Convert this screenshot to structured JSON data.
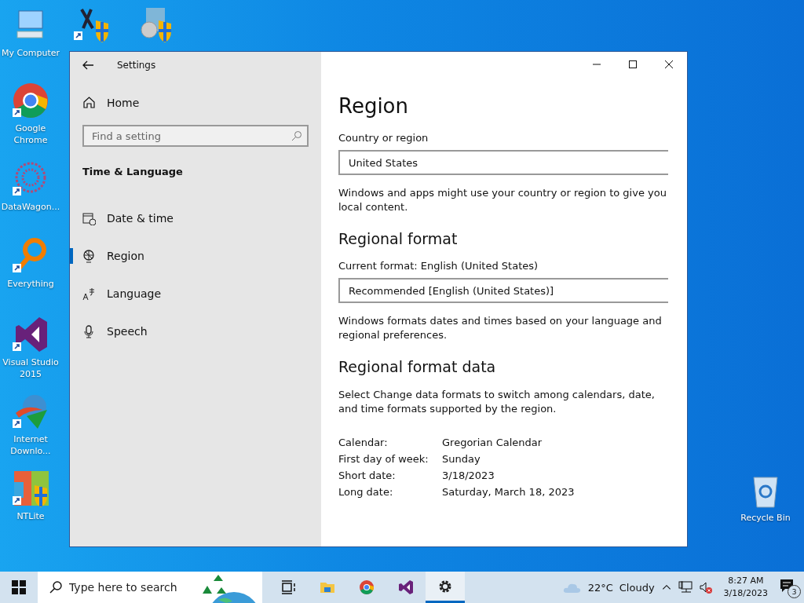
{
  "desktop_icons": [
    {
      "kind": "computer",
      "label": "My Computer"
    },
    {
      "kind": "tool-shield"
    },
    {
      "kind": "disc-shield"
    },
    {
      "kind": "chrome",
      "label": "Google Chrome"
    },
    {
      "kind": "mesh",
      "label": "DataWagon..."
    },
    {
      "kind": "magnifier",
      "label": "Everything"
    },
    {
      "kind": "vs",
      "label": "Visual Studio 2015"
    },
    {
      "kind": "globe-arrow",
      "label": "Internet Downlo..."
    },
    {
      "kind": "ntlite",
      "label": "NTLite"
    },
    {
      "kind": "recycle",
      "label": "Recycle Bin"
    }
  ],
  "window": {
    "title": "Settings",
    "home": "Home",
    "search": {
      "placeholder": "Find a setting"
    },
    "section": "Time & Language",
    "nav": [
      {
        "label": "Date & time",
        "selected": false
      },
      {
        "label": "Region",
        "selected": true
      },
      {
        "label": "Language",
        "selected": false
      },
      {
        "label": "Speech",
        "selected": false
      }
    ],
    "heading": "Region",
    "country_label": "Country or region",
    "country_value": "United States",
    "country_note": "Windows and apps might use your country or region to give you local content.",
    "format_heading": "Regional format",
    "format_label": "Current format: English (United States)",
    "format_value": "Recommended [English (United States)]",
    "format_note": "Windows formats dates and times based on your language and regional preferences.",
    "data_heading": "Regional format data",
    "data_note": "Select Change data formats to switch among calendars, date, and time formats supported by the region.",
    "data_rows": [
      {
        "label": "Calendar:",
        "value": "Gregorian Calendar"
      },
      {
        "label": "First day of week:",
        "value": "Sunday"
      },
      {
        "label": "Short date:",
        "value": "3/18/2023"
      },
      {
        "label": "Long date:",
        "value": "Saturday, March 18, 2023"
      }
    ]
  },
  "taskbar": {
    "search_placeholder": "Type here to search",
    "apps": [
      {
        "kind": "task-view",
        "active": false
      },
      {
        "kind": "folder",
        "active": false
      },
      {
        "kind": "chrome",
        "active": false
      },
      {
        "kind": "vs",
        "active": false
      },
      {
        "kind": "settings",
        "active": true
      }
    ],
    "temperature": "22°C",
    "weather": "Cloudy",
    "time": "8:27 AM",
    "date": "3/18/2023",
    "notifications": "3"
  }
}
